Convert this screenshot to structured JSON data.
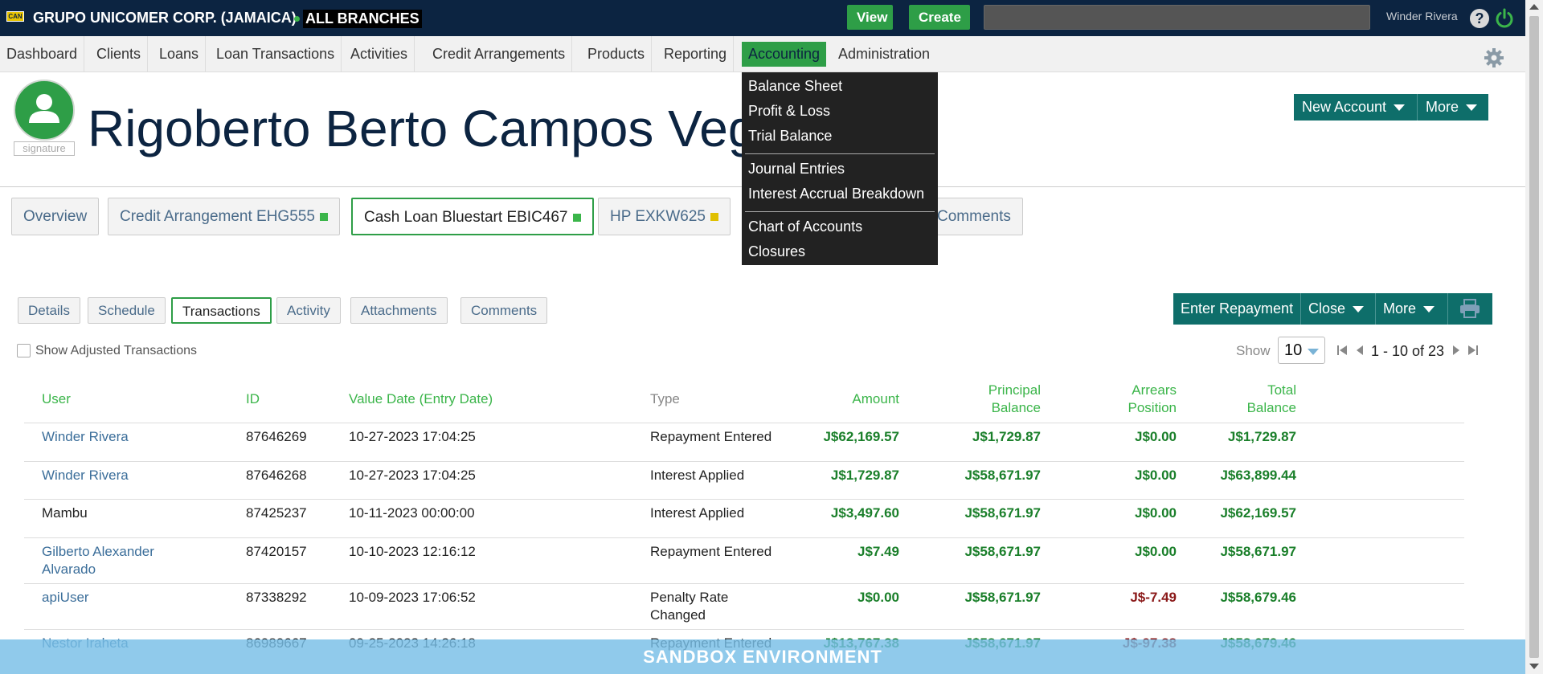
{
  "topbar": {
    "logo_text": "CAN",
    "company": "GRUPO UNICOMER CORP. (JAMAICA)",
    "branch": "ALL BRANCHES",
    "view_label": "View",
    "create_label": "Create",
    "search_placeholder": "",
    "user": "Winder Rivera",
    "help": "?"
  },
  "nav": {
    "items": [
      "Dashboard",
      "Clients",
      "Loans",
      "Loan Transactions",
      "Activities",
      "Credit Arrangements",
      "Products",
      "Reporting",
      "Accounting",
      "Administration"
    ],
    "active": "Accounting"
  },
  "accounting_menu": {
    "items": [
      "Balance Sheet",
      "Profit & Loss",
      "Trial Balance",
      "Journal Entries",
      "Interest Accrual Breakdown",
      "Chart of Accounts",
      "Closures"
    ]
  },
  "client": {
    "name": "Rigoberto Berto Campos Vega",
    "signature_label": "signature",
    "new_account_label": "New Account",
    "more_label": "More"
  },
  "account_tabs": [
    {
      "label": "Overview"
    },
    {
      "label": "Credit Arrangement EHG555",
      "status_color": "#3bb54a"
    },
    {
      "label": "Cash Loan Bluestart EBIC467",
      "status_color": "#3bb54a"
    },
    {
      "label": "HP EXKW625",
      "status_color": "#e0c000"
    },
    {
      "label": "Comments"
    }
  ],
  "sub_tabs": [
    "Details",
    "Schedule",
    "Transactions",
    "Activity",
    "Attachments",
    "Comments"
  ],
  "active_sub_tab": "Transactions",
  "actions": {
    "enter_repayment": "Enter Repayment",
    "close": "Close",
    "more": "More",
    "print_icon": "printer-icon"
  },
  "filters": {
    "show_adjusted": "Show Adjusted Transactions",
    "show_label": "Show",
    "page_size": "10",
    "pagination": "1 - 10 of 23"
  },
  "table": {
    "headers": {
      "user": "User",
      "id": "ID",
      "value_date": "Value Date (Entry Date)",
      "type": "Type",
      "amount": "Amount",
      "principal_balance_1": "Principal",
      "principal_balance_2": "Balance",
      "arrears_position_1": "Arrears",
      "arrears_position_2": "Position",
      "total_balance_1": "Total",
      "total_balance_2": "Balance"
    },
    "rows": [
      {
        "user": "Winder Rivera",
        "user2": "",
        "user_link": true,
        "id": "87646269",
        "date": "10-27-2023 17:04:25",
        "type": "Repayment Entered",
        "type2": "",
        "amount": "J$62,169.57",
        "principal": "J$1,729.87",
        "arrears": "J$0.00",
        "total": "J$1,729.87"
      },
      {
        "user": "Winder Rivera",
        "user2": "",
        "user_link": true,
        "id": "87646268",
        "date": "10-27-2023 17:04:25",
        "type": "Interest Applied",
        "type2": "",
        "amount": "J$1,729.87",
        "principal": "J$58,671.97",
        "arrears": "J$0.00",
        "total": "J$63,899.44"
      },
      {
        "user": "Mambu",
        "user2": "",
        "user_link": false,
        "id": "87425237",
        "date": "10-11-2023 00:00:00",
        "type": "Interest Applied",
        "type2": "",
        "amount": "J$3,497.60",
        "principal": "J$58,671.97",
        "arrears": "J$0.00",
        "total": "J$62,169.57"
      },
      {
        "user": "Gilberto Alexander",
        "user2": "Alvarado",
        "user_link": true,
        "id": "87420157",
        "date": "10-10-2023 12:16:12",
        "type": "Repayment Entered",
        "type2": "",
        "amount": "J$7.49",
        "principal": "J$58,671.97",
        "arrears": "J$0.00",
        "total": "J$58,671.97"
      },
      {
        "user": "apiUser",
        "user2": "",
        "user_link": true,
        "id": "87338292",
        "date": "10-09-2023 17:06:52",
        "type": "Penalty Rate",
        "type2": "Changed",
        "amount": "J$0.00",
        "principal": "J$58,671.97",
        "arrears": "J$-7.49",
        "total": "J$58,679.46"
      },
      {
        "user": "Nestor Iraheta",
        "user2": "",
        "user_link": true,
        "id": "86989667",
        "date": "09-25-2023 14:26:18",
        "type": "Repayment Entered",
        "type2": "",
        "amount": "J$13,767.38",
        "principal": "J$58,671.97",
        "arrears": "J$-97.38",
        "total": "J$58,679.46"
      }
    ]
  },
  "banner": "SANDBOX ENVIRONMENT",
  "colors": {
    "navy": "#0c2441",
    "green": "#2e9e47",
    "teal": "#0e6e6a"
  }
}
